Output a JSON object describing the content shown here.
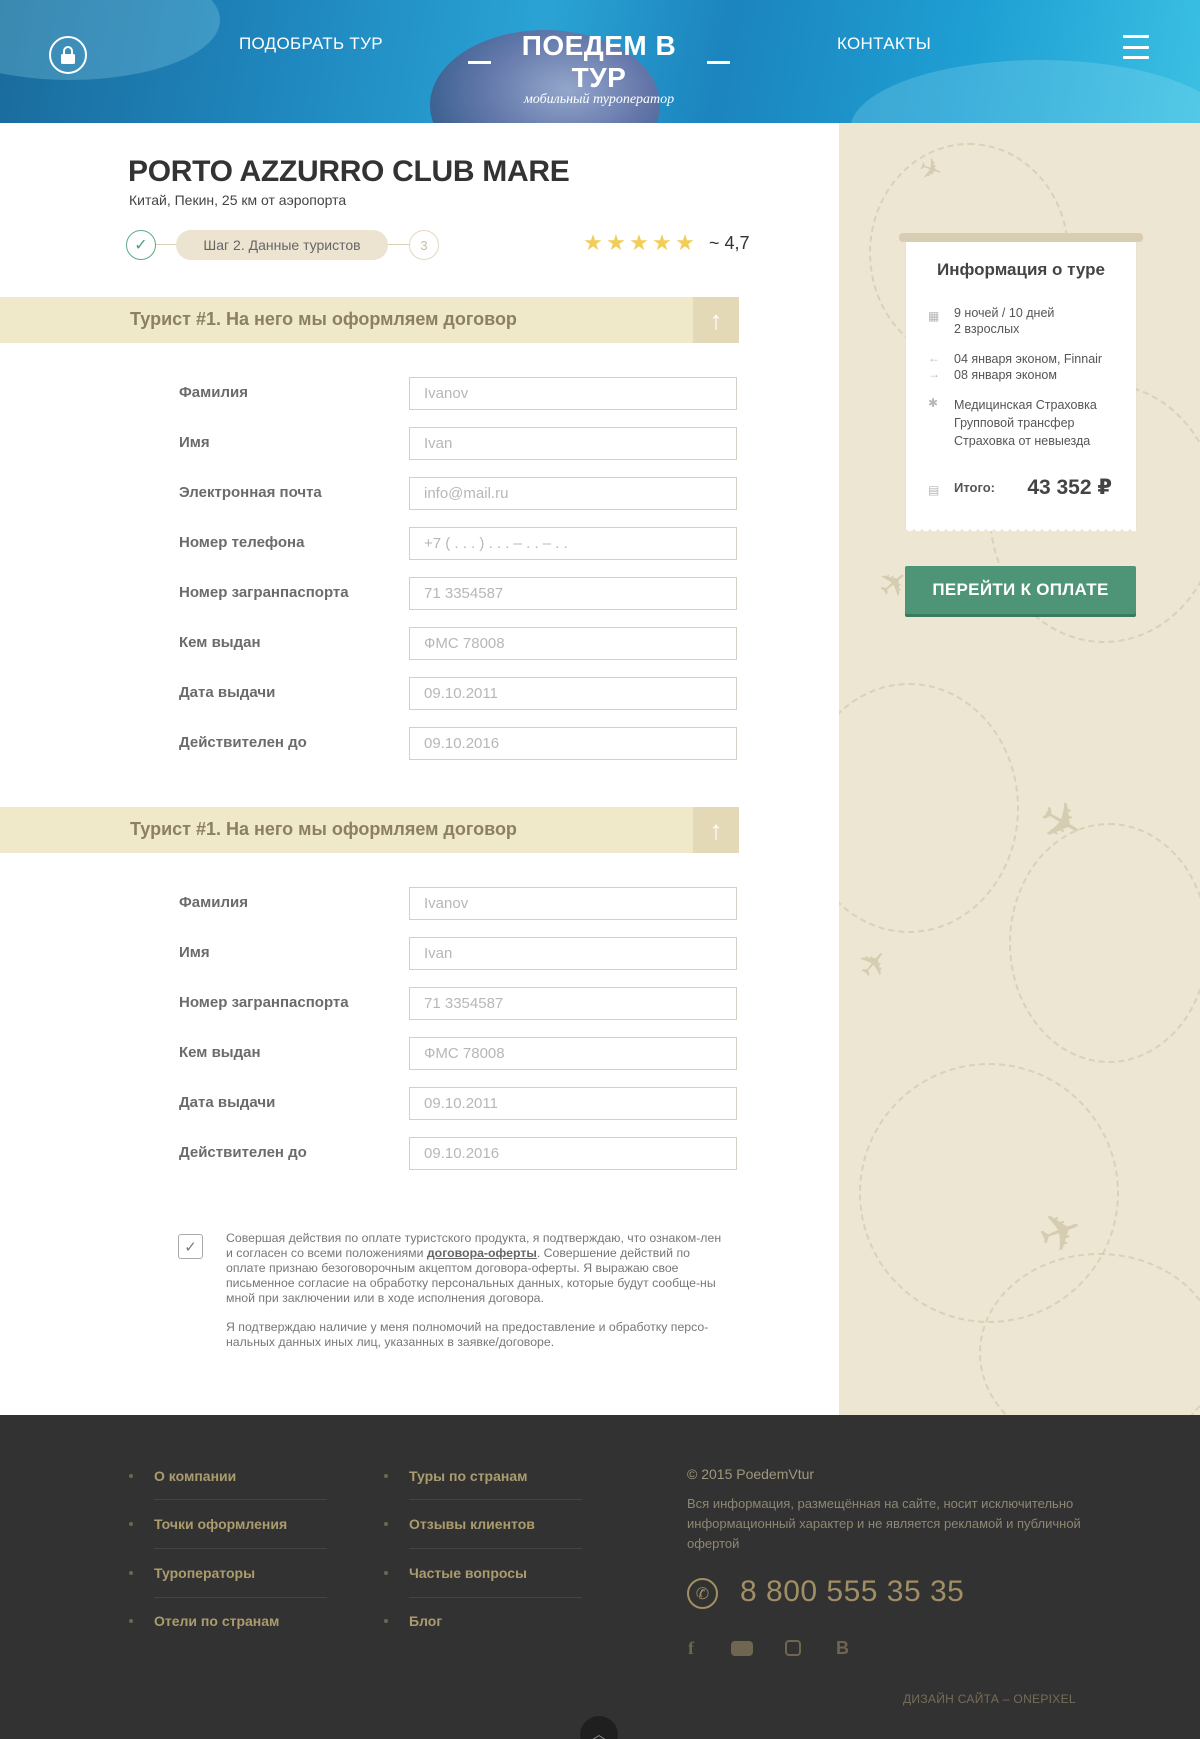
{
  "header": {
    "nav_left": "ПОДОБРАТЬ ТУР",
    "nav_right": "КОНТАКТЫ",
    "logo_title": "ПОЕДЕМ В ТУР",
    "logo_subtitle": "мобильный туроператор",
    "lock_icon": "lock-icon",
    "menu_icon": "hamburger-menu-icon"
  },
  "hotel": {
    "name": "PORTO AZZURRO CLUB MARE",
    "location": "Китай, Пекин, 25 км от аэропорта",
    "rating_value": "~ 4,7",
    "stars": 5
  },
  "steps": {
    "done_icon": "check-icon",
    "current": "Шаг 2. Данные туристов",
    "next": "3"
  },
  "tourists": [
    {
      "title": "Турист #1. На него мы оформляем договор",
      "fields": [
        {
          "label": "Фамилия",
          "value": "Ivanov"
        },
        {
          "label": "Имя",
          "value": "Ivan"
        },
        {
          "label": "Электронная почта",
          "value": "info@mail.ru"
        },
        {
          "label": "Номер телефона",
          "value": "+7 ( . . . ) . . . – . . – . ."
        },
        {
          "label": "Номер загранпаспорта",
          "value": "71 3354587"
        },
        {
          "label": "Кем выдан",
          "value": "ФМС 78008"
        },
        {
          "label": "Дата выдачи",
          "value": "09.10.2011"
        },
        {
          "label": "Действителен до",
          "value": "09.10.2016"
        }
      ]
    },
    {
      "title": "Турист #1. На него мы оформляем договор",
      "fields": [
        {
          "label": "Фамилия",
          "value": "Ivanov"
        },
        {
          "label": "Имя",
          "value": "Ivan"
        },
        {
          "label": "Номер загранпаспорта",
          "value": "71 3354587"
        },
        {
          "label": "Кем выдан",
          "value": "ФМС 78008"
        },
        {
          "label": "Дата выдачи",
          "value": "09.10.2011"
        },
        {
          "label": "Действителен до",
          "value": "09.10.2016"
        }
      ]
    }
  ],
  "agreement": {
    "checked": true,
    "p1_before": "Совершая действия по оплате туристского продукта, я подтверждаю, что ознаком-лен и согласен со всеми положениями ",
    "p1_link": "договора-оферты",
    "p1_after": ". Совершение действий по оплате признаю безоговорочным акцептом договора-оферты. Я выражаю свое письменное согласие на обработку персональных данных, которые будут сообще-ны мной при заключении или в ходе исполнения договора.",
    "p2": "Я подтверждаю наличие у меня полномочий на предоставление и обработку персо-нальных данных иных лиц, указанных в заявке/договоре."
  },
  "tour_info": {
    "title": "Информация о туре",
    "duration_line1": "9 ночей / 10 дней",
    "duration_line2": "2 взрослых",
    "flight_out": "04 января эконом, Finnair",
    "flight_back": "08 января эконом",
    "service1": "Медицинская Страховка",
    "service2": "Групповой трансфер",
    "service3": "Страховка от невыезда",
    "total_label": "Итого:",
    "total_value": "43 352 ₽"
  },
  "pay_button": "ПЕРЕЙТИ К ОПЛАТЕ",
  "footer": {
    "col1": [
      "О компании",
      "Точки оформления",
      "Туроператоры",
      "Отели  по странам"
    ],
    "col2": [
      "Туры по странам",
      "Отзывы клиентов",
      "Частые вопросы",
      "Блог"
    ],
    "copyright": "© 2015 PoedemVtur",
    "description": "Вся информация, размещённая на сайте, носит исключительно информационный характер и не является рекламой и публичной офертой",
    "phone": "8 800 555 35 35",
    "social": [
      "facebook-icon",
      "youtube-icon",
      "instagram-icon",
      "vk-icon"
    ],
    "design_credit": "ДИЗАЙН САЙТА – ONEPIXEL"
  },
  "colors": {
    "accent_green": "#4e9477",
    "section_bar": "#f0e9c9",
    "footer_bg": "#333232",
    "footer_link": "#ab9c6e",
    "star": "#f2cd58"
  }
}
